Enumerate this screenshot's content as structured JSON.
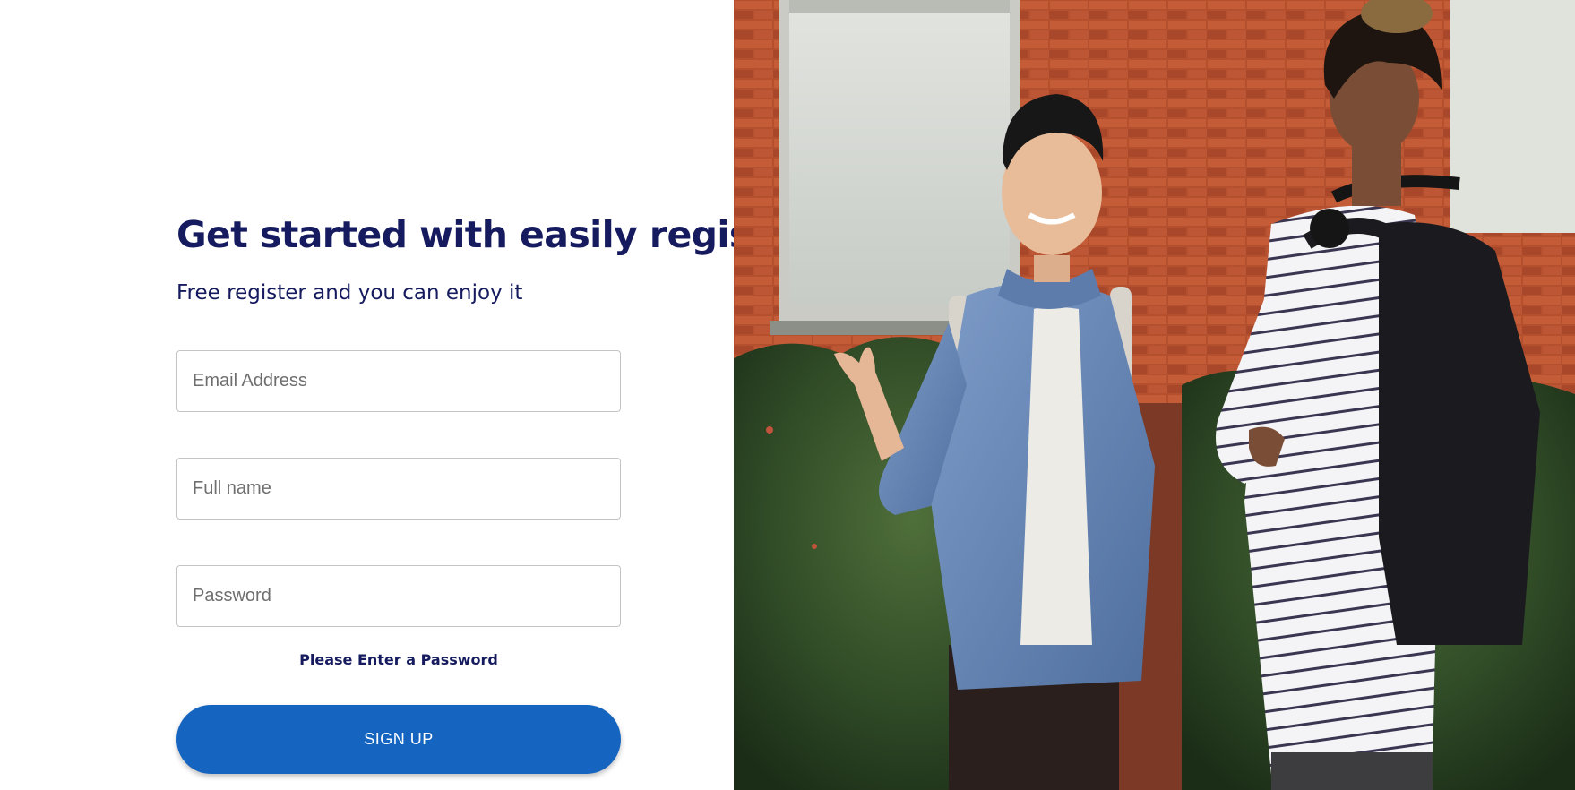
{
  "form": {
    "title": "Get started with easily register",
    "subtitle": "Free register and you can enjoy it",
    "email_placeholder": "Email Address",
    "name_placeholder": "Full name",
    "password_placeholder": "Password",
    "error_message": "Please Enter a Password",
    "submit_label": "SIGN UP"
  },
  "colors": {
    "heading": "#151b5e",
    "button": "#1565c0",
    "field_border": "#c4c4c4"
  },
  "hero": {
    "image": "students-talking-photo"
  }
}
